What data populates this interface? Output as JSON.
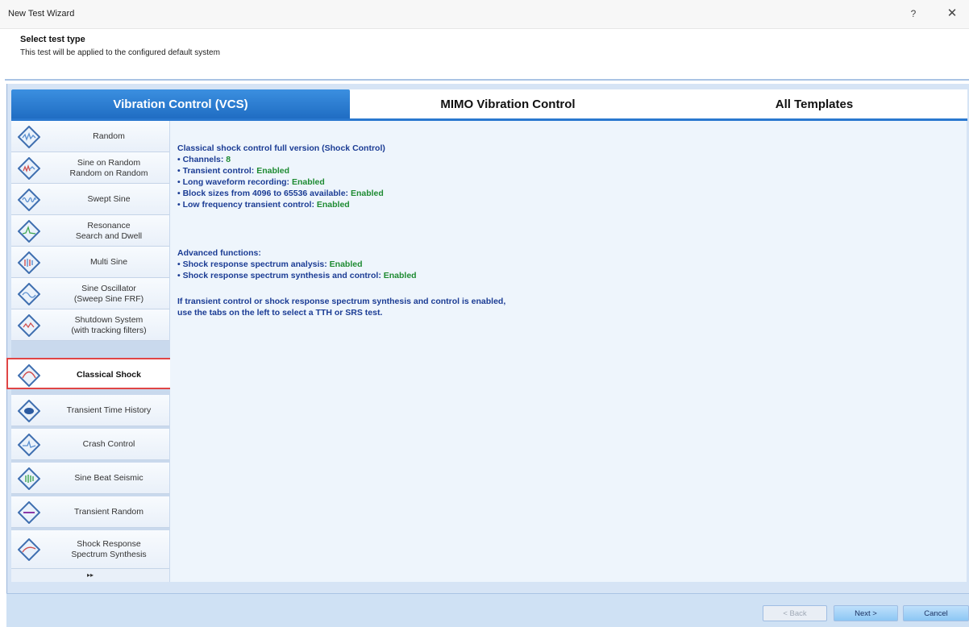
{
  "window": {
    "title": "New Test Wizard",
    "help_glyph": "?",
    "close_glyph": "✕"
  },
  "header": {
    "title": "Select test type",
    "subtitle": "This test will be applied to the configured default system"
  },
  "tabs": [
    {
      "label": "Vibration Control (VCS)",
      "active": true
    },
    {
      "label": "MIMO Vibration Control",
      "active": false
    },
    {
      "label": "All Templates",
      "active": false
    }
  ],
  "sidebar": {
    "items": [
      {
        "label": "Random",
        "icon": "random-wave-icon",
        "selected": false
      },
      {
        "label": "Sine on Random\nRandom on Random",
        "icon": "sine-on-random-icon",
        "selected": false
      },
      {
        "label": "Swept Sine",
        "icon": "swept-sine-icon",
        "selected": false
      },
      {
        "label": "Resonance\nSearch and Dwell",
        "icon": "resonance-icon",
        "selected": false
      },
      {
        "label": "Multi Sine",
        "icon": "multi-sine-icon",
        "selected": false
      },
      {
        "label": "Sine Oscillator\n(Sweep Sine FRF)",
        "icon": "sine-oscillator-icon",
        "selected": false
      },
      {
        "label": "Shutdown System\n(with tracking filters)",
        "icon": "shutdown-system-icon",
        "selected": false
      },
      {
        "label": "Classical Shock",
        "icon": "classical-shock-icon",
        "selected": true
      },
      {
        "label": "Transient Time History",
        "icon": "transient-time-history-icon",
        "selected": false
      },
      {
        "label": "Crash Control",
        "icon": "crash-control-icon",
        "selected": false
      },
      {
        "label": "Sine Beat Seismic",
        "icon": "sine-beat-seismic-icon",
        "selected": false
      },
      {
        "label": "Transient Random",
        "icon": "transient-random-icon",
        "selected": false
      },
      {
        "label": "Shock Response\nSpectrum Synthesis",
        "icon": "srs-synthesis-icon",
        "selected": false
      }
    ],
    "more_glyph": "▸▸"
  },
  "content": {
    "heading": "Classical shock control full version (Shock Control)",
    "bullets": [
      {
        "label": "• Channels: ",
        "value": "8"
      },
      {
        "label": "• Transient control: ",
        "value": "Enabled"
      },
      {
        "label": "• Long waveform recording: ",
        "value": "Enabled"
      },
      {
        "label": "• Block sizes from 4096 to 65536 available: ",
        "value": "Enabled"
      },
      {
        "label": "• Low frequency transient control: ",
        "value": "Enabled"
      }
    ],
    "advanced_heading": "Advanced functions:",
    "advanced": [
      {
        "label": "• Shock response spectrum analysis: ",
        "value": "Enabled"
      },
      {
        "label": "• Shock response spectrum synthesis and control: ",
        "value": "Enabled"
      }
    ],
    "note_line1": "If transient control or shock response spectrum synthesis and control is enabled,",
    "note_line2": "use the tabs on the left to select a TTH or SRS test."
  },
  "footer": {
    "back_label": "< Back",
    "next_label": "Next >",
    "cancel_label": "Cancel"
  },
  "colors": {
    "accent": "#1f6cc2",
    "enabled_green": "#1e8b32",
    "text_blue": "#1b3c94",
    "selection_border": "#e04545"
  }
}
